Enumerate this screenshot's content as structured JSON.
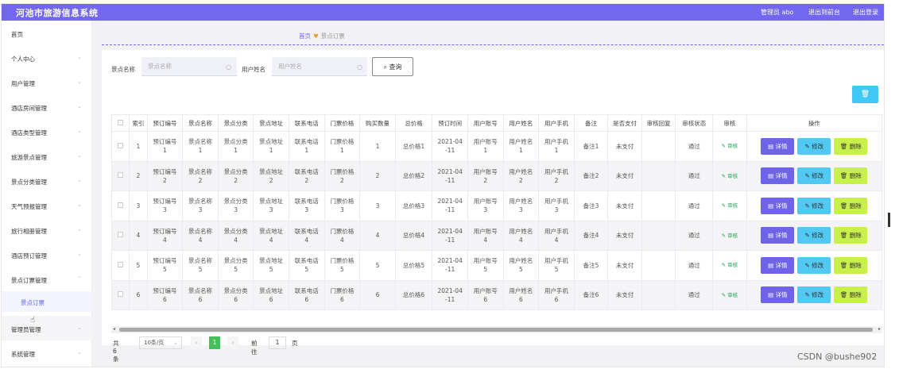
{
  "app": {
    "title": "河池市旅游信息系统"
  },
  "topbar": {
    "admin": "管理员 abo",
    "back": "退出到前台",
    "logout": "退出登录"
  },
  "sidebar": {
    "items": [
      {
        "label": "首页"
      },
      {
        "label": "个人中心"
      },
      {
        "label": "用户管理"
      },
      {
        "label": "酒店房间管理"
      },
      {
        "label": "酒店类型管理"
      },
      {
        "label": "旅游景点管理"
      },
      {
        "label": "景点分类管理"
      },
      {
        "label": "天气预报管理"
      },
      {
        "label": "旅行相册管理"
      },
      {
        "label": "酒店预订管理"
      },
      {
        "label": "景点订票管理"
      },
      {
        "label": "管理员管理"
      },
      {
        "label": "系统管理"
      }
    ],
    "sub_item": "景点订票"
  },
  "breadcrumb": {
    "home": "首页",
    "sep": "♥",
    "current": "景点订票"
  },
  "search": {
    "name_label": "景点名称",
    "name_placeholder": "景点名称",
    "user_label": "用户姓名",
    "user_placeholder": "用户姓名",
    "button": "查询"
  },
  "colors": {
    "accent": "#7367f0",
    "detail": "#6f63e8",
    "edit": "#52c9f2",
    "delete": "#c8f04a",
    "review": "#26a65b"
  },
  "table": {
    "headers": [
      "",
      "索引",
      "预订编号",
      "景点名称",
      "景点分类",
      "景点地址",
      "联系电话",
      "门票价格",
      "购买数量",
      "总价格",
      "预订时间",
      "用户账号",
      "用户姓名",
      "用户手机",
      "备注",
      "是否支付",
      "审核回复",
      "审核状态",
      "审核",
      "操作"
    ],
    "rows": [
      {
        "idx": "1",
        "order": "预订编号\n1",
        "name": "景点名称\n1",
        "cat": "景点分类\n1",
        "addr": "景点地址\n1",
        "phone": "联系电话\n1",
        "price": "门票价格\n1",
        "qty": "1",
        "total": "总价格1",
        "time": "2021-04\n-11",
        "acct": "用户账号\n1",
        "uname": "用户姓名\n1",
        "mobile": "用户手机\n1",
        "remark": "备注1",
        "paid": "未支付",
        "reply": "",
        "status": "通过",
        "review": "✎ 审核"
      },
      {
        "idx": "2",
        "order": "预订编号\n2",
        "name": "景点名称\n2",
        "cat": "景点分类\n2",
        "addr": "景点地址\n2",
        "phone": "联系电话\n2",
        "price": "门票价格\n2",
        "qty": "2",
        "total": "总价格2",
        "time": "2021-04\n-11",
        "acct": "用户账号\n2",
        "uname": "用户姓名\n2",
        "mobile": "用户手机\n2",
        "remark": "备注2",
        "paid": "未支付",
        "reply": "",
        "status": "通过",
        "review": "✎ 审核"
      },
      {
        "idx": "3",
        "order": "预订编号\n3",
        "name": "景点名称\n3",
        "cat": "景点分类\n3",
        "addr": "景点地址\n3",
        "phone": "联系电话\n3",
        "price": "门票价格\n3",
        "qty": "3",
        "total": "总价格3",
        "time": "2021-04\n-11",
        "acct": "用户账号\n3",
        "uname": "用户姓名\n3",
        "mobile": "用户手机\n3",
        "remark": "备注3",
        "paid": "未支付",
        "reply": "",
        "status": "通过",
        "review": "✎ 审核"
      },
      {
        "idx": "4",
        "order": "预订编号\n4",
        "name": "景点名称\n4",
        "cat": "景点分类\n4",
        "addr": "景点地址\n4",
        "phone": "联系电话\n4",
        "price": "门票价格\n4",
        "qty": "4",
        "total": "总价格4",
        "time": "2021-04\n-11",
        "acct": "用户账号\n4",
        "uname": "用户姓名\n4",
        "mobile": "用户手机\n4",
        "remark": "备注4",
        "paid": "未支付",
        "reply": "",
        "status": "通过",
        "review": "✎ 审核"
      },
      {
        "idx": "5",
        "order": "预订编号\n5",
        "name": "景点名称\n5",
        "cat": "景点分类\n5",
        "addr": "景点地址\n5",
        "phone": "联系电话\n5",
        "price": "门票价格\n5",
        "qty": "5",
        "total": "总价格5",
        "time": "2021-04\n-11",
        "acct": "用户账号\n5",
        "uname": "用户姓名\n5",
        "mobile": "用户手机\n5",
        "remark": "备注5",
        "paid": "未支付",
        "reply": "",
        "status": "通过",
        "review": "✎ 审核"
      },
      {
        "idx": "6",
        "order": "预订编号\n6",
        "name": "景点名称\n6",
        "cat": "景点分类\n6",
        "addr": "景点地址\n6",
        "phone": "联系电话\n6",
        "price": "门票价格\n6",
        "qty": "6",
        "total": "总价格6",
        "time": "2021-04\n-11",
        "acct": "用户账号\n6",
        "uname": "用户姓名\n6",
        "mobile": "用户手机\n6",
        "remark": "备注6",
        "paid": "未支付",
        "reply": "",
        "status": "通过",
        "review": "✎ 审核"
      }
    ],
    "ops": {
      "detail": "▤ 详情",
      "edit": "✎ 修改",
      "delete": "🗑 删除"
    }
  },
  "pager": {
    "total": "共 6 条",
    "size": "10条/页",
    "current": "1",
    "goto": "前往",
    "goto_value": "1",
    "page_unit": "页"
  },
  "watermark": "CSDN @bushe902"
}
